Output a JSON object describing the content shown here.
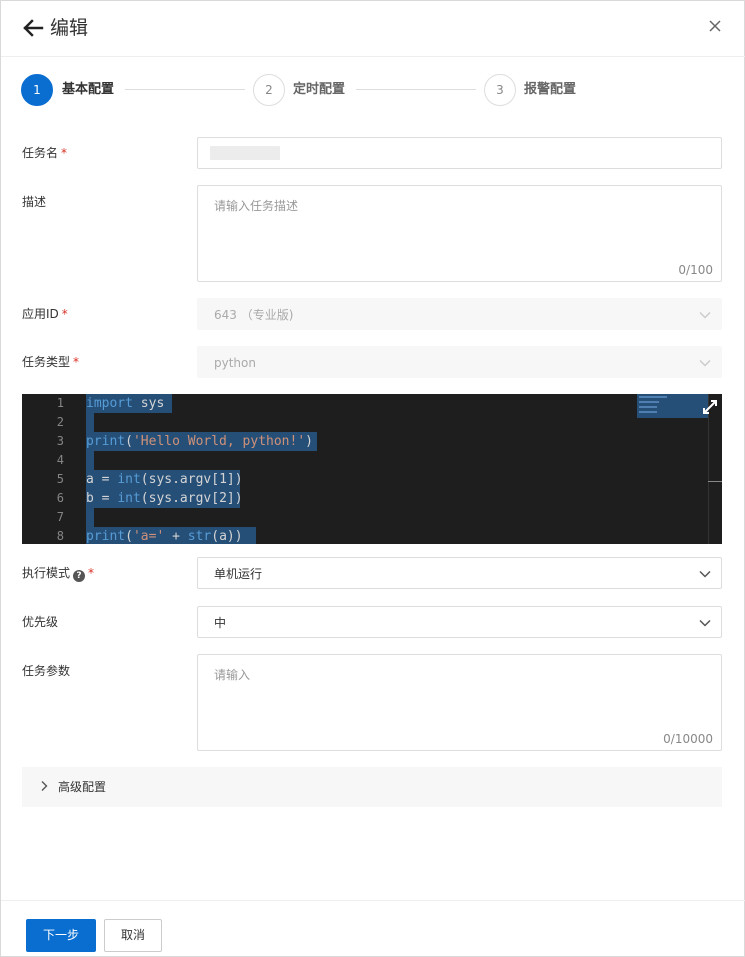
{
  "header": {
    "title": "编辑"
  },
  "steps": [
    {
      "number": "1",
      "label": "基本配置",
      "state": "active"
    },
    {
      "number": "2",
      "label": "定时配置",
      "state": "inactive"
    },
    {
      "number": "3",
      "label": "报警配置",
      "state": "inactive"
    }
  ],
  "form": {
    "task_name": {
      "label": "任务名",
      "required_mark": "*",
      "value": ""
    },
    "description": {
      "label": "描述",
      "placeholder": "请输入任务描述",
      "counter": "0/100"
    },
    "app_id": {
      "label": "应用ID",
      "required_mark": "*",
      "value": "643 （专业版)"
    },
    "task_type": {
      "label": "任务类型",
      "required_mark": "*",
      "value": "python"
    },
    "exec_mode": {
      "label": "执行模式",
      "help": "?",
      "required_mark": "*",
      "value": "单机运行"
    },
    "priority": {
      "label": "优先级",
      "value": "中"
    },
    "task_params": {
      "label": "任务参数",
      "placeholder": "请输入",
      "counter": "0/10000"
    }
  },
  "editor": {
    "line_numbers": [
      "1",
      "2",
      "3",
      "4",
      "5",
      "6",
      "7",
      "8"
    ]
  },
  "advanced": {
    "label": "高级配置"
  },
  "footer": {
    "next_label": "下一步",
    "cancel_label": "取消"
  },
  "colors": {
    "primary": "#0a6ed1",
    "required": "#d93026",
    "editor_bg": "#1e1e1e",
    "selection": "#264f78"
  }
}
